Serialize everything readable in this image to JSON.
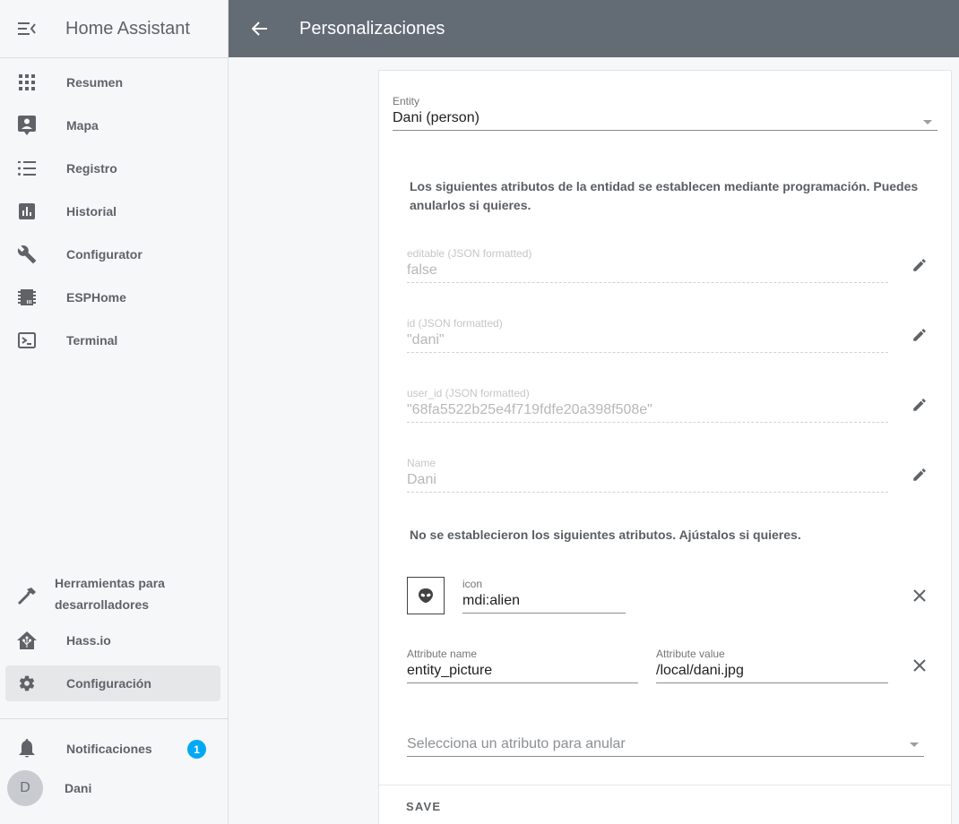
{
  "sidebar": {
    "title": "Home Assistant",
    "items": [
      {
        "label": "Resumen",
        "icon": "view-dashboard-icon"
      },
      {
        "label": "Mapa",
        "icon": "account-location-icon"
      },
      {
        "label": "Registro",
        "icon": "format-list-bulleted-icon"
      },
      {
        "label": "Historial",
        "icon": "chart-box-icon"
      },
      {
        "label": "Configurator",
        "icon": "wrench-icon"
      },
      {
        "label": "ESPHome",
        "icon": "chip-icon"
      },
      {
        "label": "Terminal",
        "icon": "console-icon"
      }
    ],
    "bottom_items": [
      {
        "label": "Herramientas para desarrolladores",
        "icon": "hammer-icon"
      },
      {
        "label": "Hass.io",
        "icon": "home-assistant-icon"
      },
      {
        "label": "Configuración",
        "icon": "cog-icon",
        "active": true
      }
    ],
    "notifications": {
      "label": "Notificaciones",
      "count": "1"
    },
    "user": {
      "name": "Dani",
      "initial": "D"
    }
  },
  "header": {
    "title": "Personalizaciones"
  },
  "form": {
    "entity": {
      "label": "Entity",
      "value": "Dani (person)"
    },
    "note_programmatic": "Los siguientes atributos de la entidad se establecen mediante programación. Puedes anularlos si quieres.",
    "programmatic_attributes": [
      {
        "label": "editable (JSON formatted)",
        "value": "false"
      },
      {
        "label": "id (JSON formatted)",
        "value": "\"dani\""
      },
      {
        "label": "user_id (JSON formatted)",
        "value": "\"68fa5522b25e4f719fdfe20a398f508e\""
      },
      {
        "label": "Name",
        "value": "Dani"
      }
    ],
    "note_unset": "No se establecieron los siguientes atributos. Ajústalos si quieres.",
    "icon_attribute": {
      "label": "icon",
      "value": "mdi:alien"
    },
    "custom_attribute": {
      "name_label": "Attribute name",
      "name_value": "entity_picture",
      "value_label": "Attribute value",
      "value_value": "/local/dani.jpg"
    },
    "select_attribute_placeholder": "Selecciona un atributo para anular",
    "save_label": "SAVE"
  },
  "colors": {
    "header_bg": "#636b75",
    "badge": "#03a9f4",
    "sidebar_bg": "#f6f7f9"
  }
}
